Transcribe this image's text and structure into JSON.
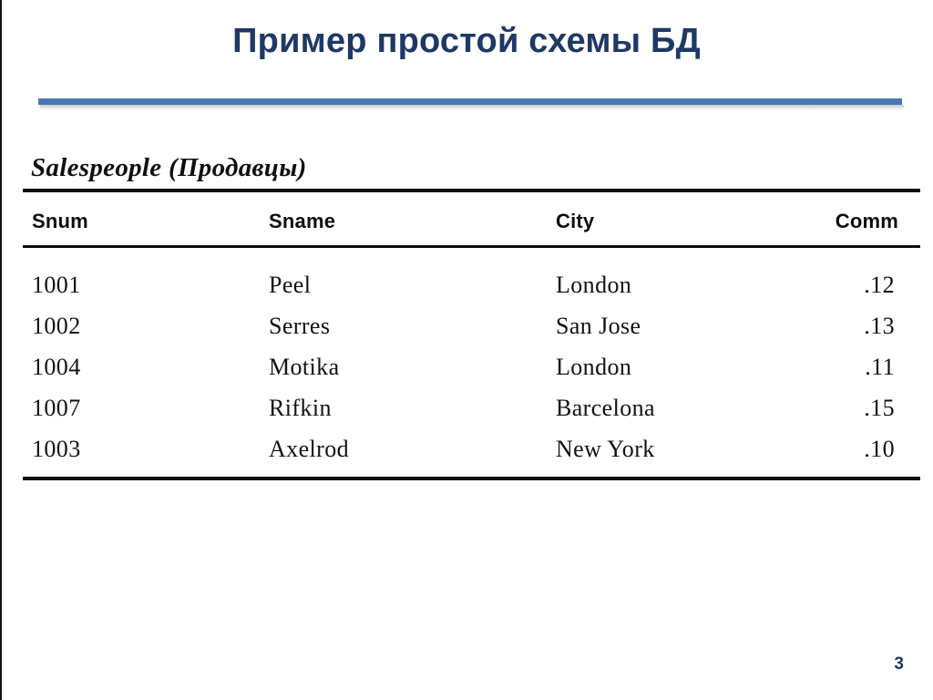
{
  "slide": {
    "title": "Пример простой схемы БД",
    "page_number": "3",
    "colors": {
      "title_text": "#1F3864",
      "title_rule": "#4A77B4",
      "page_number": "#1F3864",
      "table_rule": "#0d0d0d",
      "background": "#ffffff"
    }
  },
  "table": {
    "caption": "Salespeople (Продавцы)",
    "columns": [
      {
        "key": "snum",
        "label": "Snum",
        "align": "left"
      },
      {
        "key": "sname",
        "label": "Sname",
        "align": "left"
      },
      {
        "key": "city",
        "label": "City",
        "align": "left"
      },
      {
        "key": "comm",
        "label": "Comm",
        "align": "right"
      }
    ],
    "rows": [
      {
        "snum": "1001",
        "sname": "Peel",
        "city": "London",
        "comm": ".12"
      },
      {
        "snum": "1002",
        "sname": "Serres",
        "city": "San Jose",
        "comm": ".13"
      },
      {
        "snum": "1004",
        "sname": "Motika",
        "city": "London",
        "comm": ".11"
      },
      {
        "snum": "1007",
        "sname": "Rifkin",
        "city": "Barcelona",
        "comm": ".15"
      },
      {
        "snum": "1003",
        "sname": "Axelrod",
        "city": "New York",
        "comm": ".10"
      }
    ]
  }
}
